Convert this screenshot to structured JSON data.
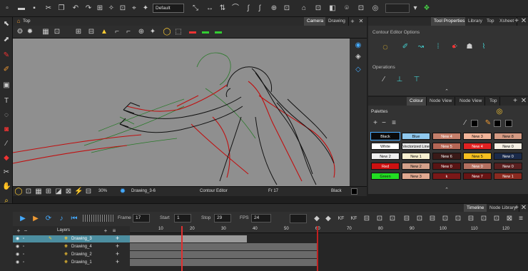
{
  "toolbar": {
    "mode_select": "Default",
    "zoom_field": ""
  },
  "view": {
    "tab_camera": "Camera",
    "tab_drawing": "Drawing",
    "breadcrumb": "Top",
    "zoom": "30%",
    "drawing_name": "Drawing_3-6",
    "tool_name": "Contour Editor",
    "frame": "Fr 17",
    "colour_name": "Black"
  },
  "tool_properties": {
    "tabs": [
      "Tool Properties",
      "Library",
      "Top",
      "Xsheet"
    ],
    "title": "Contour Editor Options",
    "operations": "Operations"
  },
  "colour_panel": {
    "tabs": [
      "Colour",
      "Node View",
      "Node View",
      "Top"
    ],
    "palettes_label": "Palettes",
    "swatches": [
      {
        "label": "Black",
        "color": "#0a0a0a",
        "text": "#fff"
      },
      {
        "label": "Blue",
        "color": "#8fc8ee",
        "text": "#111"
      },
      {
        "label": "New 4",
        "color": "#c47f6b",
        "text": "#fff"
      },
      {
        "label": "New 3",
        "color": "#f2b59a",
        "text": "#111"
      },
      {
        "label": "New 8",
        "color": "#d49a83",
        "text": "#111"
      },
      {
        "label": "White",
        "color": "#ffffff",
        "text": "#111"
      },
      {
        "label": "Vectorized Line",
        "color": "#e8e8e8",
        "text": "#111"
      },
      {
        "label": "New 5",
        "color": "#b56655",
        "text": "#fff"
      },
      {
        "label": "New 4",
        "color": "#e02222",
        "text": "#fff"
      },
      {
        "label": "New 0",
        "color": "#f4efe4",
        "text": "#111"
      },
      {
        "label": "New 2",
        "color": "#efefef",
        "text": "#111"
      },
      {
        "label": "New 1",
        "color": "#f8f0d0",
        "text": "#111"
      },
      {
        "label": "New 6",
        "color": "#3a1a18",
        "text": "#fff"
      },
      {
        "label": "New 5",
        "color": "#f4c020",
        "text": "#111"
      },
      {
        "label": "New 0",
        "color": "#1a2a4a",
        "text": "#fff"
      },
      {
        "label": "Red",
        "color": "#cc1111",
        "text": "#fff"
      },
      {
        "label": "New 2",
        "color": "#d4a08a",
        "text": "#111"
      },
      {
        "label": "New 0",
        "color": "#5a1414",
        "text": "#fff"
      },
      {
        "label": "New 0",
        "color": "#b47060",
        "text": "#fff"
      },
      {
        "label": "New 0",
        "color": "#5a2020",
        "text": "#fff"
      },
      {
        "label": "Green",
        "color": "#22dd22",
        "text": "#111"
      },
      {
        "label": "New 3",
        "color": "#e0a890",
        "text": "#111"
      },
      {
        "label": "k",
        "color": "#7a1818",
        "text": "#fff"
      },
      {
        "label": "New 7",
        "color": "#6a1414",
        "text": "#fff"
      },
      {
        "label": "New 1",
        "color": "#8a2a20",
        "text": "#fff"
      }
    ]
  },
  "timeline": {
    "tabs": [
      "Timeline",
      "Node Library"
    ],
    "frame_label": "Frame",
    "frame": "17",
    "start_label": "Start",
    "start": "1",
    "stop_label": "Stop",
    "stop": "29",
    "fps_label": "FPS",
    "fps": "24",
    "layers_label": "Layers",
    "ruler": [
      "10",
      "20",
      "30",
      "40",
      "50",
      "60",
      "70",
      "80",
      "90",
      "100",
      "110",
      "120"
    ],
    "layers": [
      "Drawing_3",
      "Drawing_4",
      "Drawing_2",
      "Drawing_1"
    ]
  }
}
